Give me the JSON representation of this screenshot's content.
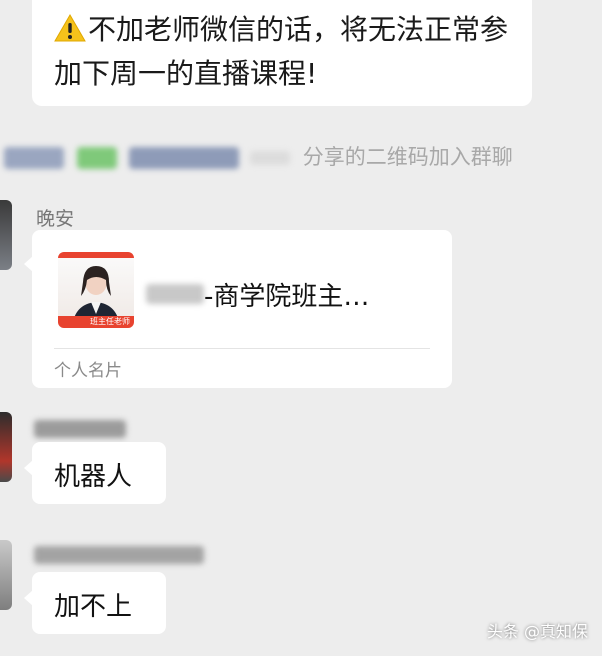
{
  "announcement": {
    "icon": "warning-icon",
    "text": "不加老师微信的话，将无法正常参加下周一的直播课程!"
  },
  "system_notice": {
    "suffix": "分享的二维码加入群聊"
  },
  "messages": [
    {
      "sender": "晚安",
      "type": "contact_card",
      "card_name": "-商学院班主…",
      "card_label": "个人名片",
      "photo_caption": "班主任老师"
    },
    {
      "sender": "",
      "type": "text",
      "text": "机器人"
    },
    {
      "sender": "",
      "type": "text",
      "text": "加不上"
    }
  ],
  "watermark": "头条 @真知保",
  "colors": {
    "background": "#ededed",
    "bubble": "#ffffff",
    "card_accent": "#e8432f"
  }
}
